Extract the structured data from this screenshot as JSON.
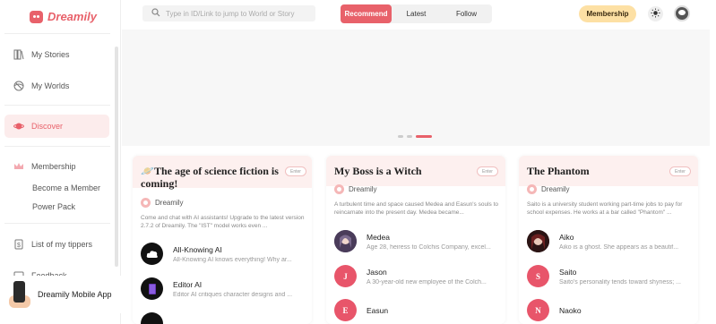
{
  "app": {
    "name": "Dreamily"
  },
  "sidebar": {
    "items": [
      {
        "label": "My Stories",
        "icon": "books-icon"
      },
      {
        "label": "My Worlds",
        "icon": "globe-icon"
      },
      {
        "label": "Discover",
        "icon": "planet-icon",
        "active": true
      },
      {
        "label": "Membership",
        "icon": "crown-icon"
      },
      {
        "label": "List of my tippers",
        "icon": "tip-icon"
      },
      {
        "label": "Feedback",
        "icon": "feedback-icon"
      }
    ],
    "membership_sub": [
      "Become a Member",
      "Power Pack"
    ],
    "mobile_app_label": "Dreamily Mobile App"
  },
  "header": {
    "search_placeholder": "Type in ID/Link to jump to World or Story",
    "tabs": [
      "Recommend",
      "Latest",
      "Follow"
    ],
    "active_tab": "Recommend",
    "membership_button": "Membership"
  },
  "banner": {
    "dots": 3,
    "active_dot": 3
  },
  "cards": [
    {
      "emoji": "🪐",
      "title": "The age of science fiction is coming!",
      "enter": "Enter",
      "author": "Dreamily",
      "description": "Come and chat with AI assistants! Upgrade to the latest version 2.7.2 of Dreamily. The \"IST\" model works even ...",
      "characters": [
        {
          "name": "All-Knowing AI",
          "desc": "All-Knowing AI knows everything! Why ar...",
          "avatar": "cloud"
        },
        {
          "name": "Editor AI",
          "desc": "Editor AI critiques character designs and ...",
          "avatar": "book"
        }
      ]
    },
    {
      "emoji": "",
      "title": "My Boss is a Witch",
      "enter": "Enter",
      "author": "Dreamily",
      "description": "A turbulent time and space caused Medea and Easun's souls to reincarnate into the present day. Medea became...",
      "characters": [
        {
          "name": "Medea",
          "desc": "Age 28, heiress to Colchis Company, excel...",
          "avatar": "portrait"
        },
        {
          "name": "Jason",
          "desc": "A 30-year-old new employee of the Colch...",
          "avatar": "J"
        },
        {
          "name": "Easun",
          "desc": "",
          "avatar": "E"
        }
      ]
    },
    {
      "emoji": "",
      "title": "The Phantom",
      "enter": "Enter",
      "author": "Dreamily",
      "description": "Saito is a university student working part-time jobs to pay for school expenses. He works at a bar called \"Phantom\" ...",
      "characters": [
        {
          "name": "Aiko",
          "desc": "Aiko is a ghost. She appears as a beautif...",
          "avatar": "portrait2"
        },
        {
          "name": "Saito",
          "desc": "Saito's personality tends toward shyness; ...",
          "avatar": "S"
        },
        {
          "name": "Naoko",
          "desc": "",
          "avatar": "N"
        }
      ]
    }
  ],
  "colors": {
    "accent": "#e8616a",
    "membership": "#fde0a4",
    "card_head": "#fdf0ef"
  }
}
